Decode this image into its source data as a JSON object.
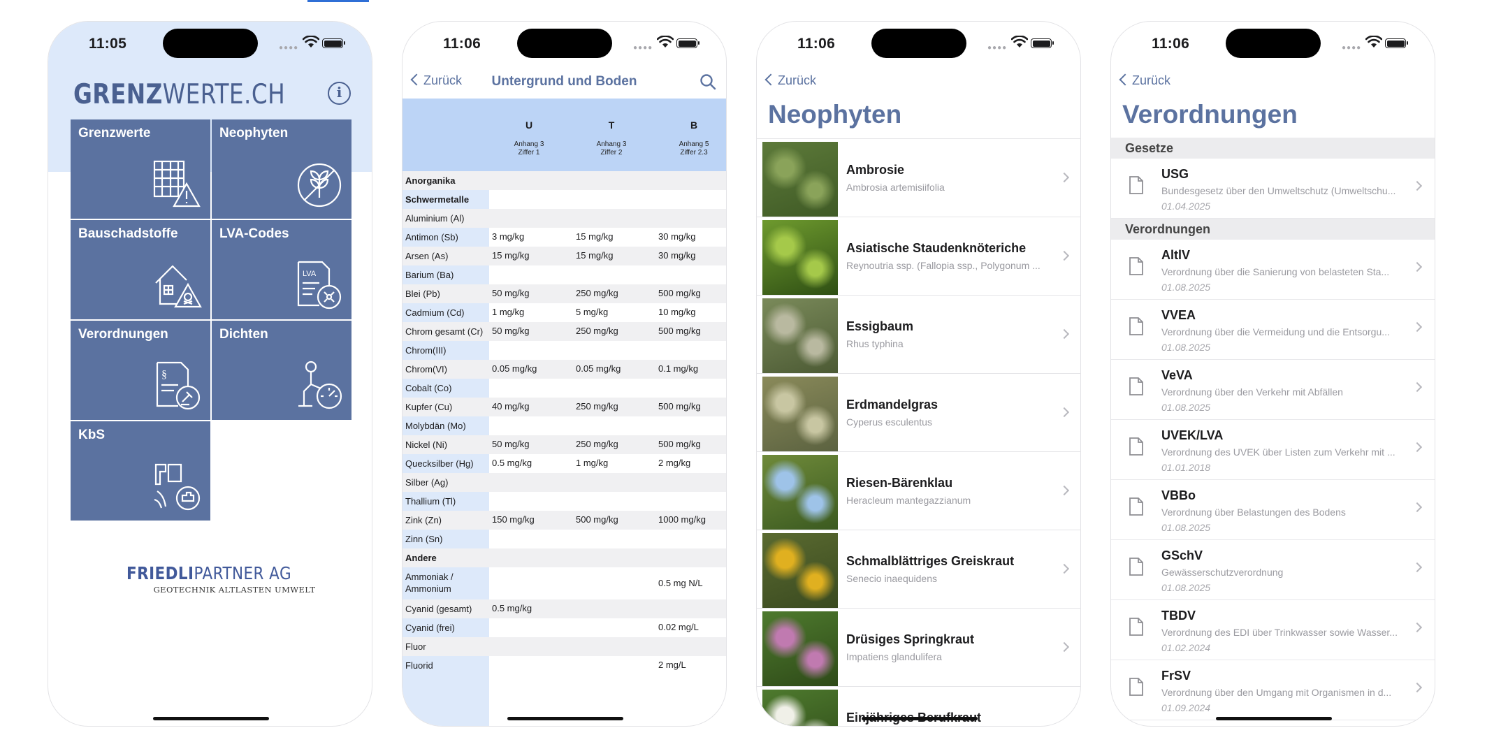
{
  "status": {
    "time_1": "11:05",
    "time_2": "11:06",
    "time_3": "11:06",
    "time_4": "11:06"
  },
  "home": {
    "logo_bold": "GRENZ",
    "logo_regular": "WERTE.CH",
    "tiles": [
      {
        "label": "Grenzwerte",
        "icon": "grid-warning-icon"
      },
      {
        "label": "Neophyten",
        "icon": "plant-circle-icon"
      },
      {
        "label": "Bauschadstoffe",
        "icon": "house-hazard-icon"
      },
      {
        "label": "LVA-Codes",
        "icon": "lva-document-icon"
      },
      {
        "label": "Verordnungen",
        "icon": "legal-document-icon"
      },
      {
        "label": "Dichten",
        "icon": "gauge-person-icon"
      },
      {
        "label": "KbS",
        "icon": "site-document-icon"
      }
    ],
    "company_bold": "FRIEDLI",
    "company_regular": "PARTNER AG",
    "company_tagline": "GEOTECHNIK ALTLASTEN UMWELT"
  },
  "soil": {
    "back": "Zurück",
    "title": "Untergrund und Boden",
    "columns": [
      {
        "key": "U",
        "sub1": "Anhang 3",
        "sub2": "Ziffer 1"
      },
      {
        "key": "T",
        "sub1": "Anhang 3",
        "sub2": "Ziffer 2"
      },
      {
        "key": "B",
        "sub1": "Anhang 5",
        "sub2": "Ziffer 2.3"
      }
    ],
    "rows": [
      {
        "label": "Anorganika",
        "header": true,
        "values": [
          "",
          "",
          ""
        ]
      },
      {
        "label": "Schwermetalle",
        "header": true,
        "values": [
          "",
          "",
          ""
        ]
      },
      {
        "label": "Aluminium (Al)",
        "values": [
          "",
          "",
          ""
        ]
      },
      {
        "label": "Antimon (Sb)",
        "values": [
          "3 mg/kg",
          "15 mg/kg",
          "30 mg/kg"
        ]
      },
      {
        "label": "Arsen (As)",
        "values": [
          "15 mg/kg",
          "15 mg/kg",
          "30 mg/kg"
        ]
      },
      {
        "label": "Barium (Ba)",
        "values": [
          "",
          "",
          ""
        ]
      },
      {
        "label": "Blei (Pb)",
        "values": [
          "50 mg/kg",
          "250 mg/kg",
          "500 mg/kg"
        ]
      },
      {
        "label": "Cadmium (Cd)",
        "values": [
          "1 mg/kg",
          "5 mg/kg",
          "10 mg/kg"
        ]
      },
      {
        "label": "Chrom gesamt (Cr)",
        "values": [
          "50 mg/kg",
          "250 mg/kg",
          "500 mg/kg"
        ]
      },
      {
        "label": "Chrom(III)",
        "values": [
          "",
          "",
          ""
        ]
      },
      {
        "label": "Chrom(VI)",
        "values": [
          "0.05 mg/kg",
          "0.05 mg/kg",
          "0.1 mg/kg"
        ]
      },
      {
        "label": "Cobalt (Co)",
        "values": [
          "",
          "",
          ""
        ]
      },
      {
        "label": "Kupfer (Cu)",
        "values": [
          "40 mg/kg",
          "250 mg/kg",
          "500 mg/kg"
        ]
      },
      {
        "label": "Molybdän (Mo)",
        "values": [
          "",
          "",
          ""
        ]
      },
      {
        "label": "Nickel (Ni)",
        "values": [
          "50 mg/kg",
          "250 mg/kg",
          "500 mg/kg"
        ]
      },
      {
        "label": "Quecksilber (Hg)",
        "values": [
          "0.5 mg/kg",
          "1 mg/kg",
          "2 mg/kg"
        ]
      },
      {
        "label": "Silber (Ag)",
        "values": [
          "",
          "",
          ""
        ]
      },
      {
        "label": "Thallium (Tl)",
        "values": [
          "",
          "",
          ""
        ]
      },
      {
        "label": "Zink (Zn)",
        "values": [
          "150 mg/kg",
          "500 mg/kg",
          "1000 mg/kg"
        ]
      },
      {
        "label": "Zinn (Sn)",
        "values": [
          "",
          "",
          ""
        ]
      },
      {
        "label": "Andere",
        "header": true,
        "values": [
          "",
          "",
          ""
        ]
      },
      {
        "label": "Ammoniak / Ammonium",
        "values": [
          "",
          "",
          "0.5 mg N/L"
        ]
      },
      {
        "label": "Cyanid (gesamt)",
        "values": [
          "0.5 mg/kg",
          "",
          ""
        ]
      },
      {
        "label": "Cyanid (frei)",
        "values": [
          "",
          "",
          "0.02 mg/L"
        ]
      },
      {
        "label": "Fluor",
        "values": [
          "",
          "",
          ""
        ]
      },
      {
        "label": "Fluorid",
        "values": [
          "",
          "",
          "2 mg/L"
        ]
      }
    ]
  },
  "neo": {
    "back": "Zurück",
    "title": "Neophyten",
    "items": [
      {
        "name": "Ambrosie",
        "latin": "Ambrosia artemisiifolia",
        "colors": [
          "#5d7a3a",
          "#8aa35a",
          "#3f5a25"
        ]
      },
      {
        "name": "Asiatische Staudenknöteriche",
        "latin": "Reynoutria ssp. (Fallopia ssp., Polygonum ...",
        "colors": [
          "#6e9a2e",
          "#a5c94a",
          "#2f4f14"
        ]
      },
      {
        "name": "Essigbaum",
        "latin": "Rhus typhina",
        "colors": [
          "#7a8a5a",
          "#b9b9a0",
          "#4c5a34"
        ]
      },
      {
        "name": "Erdmandelgras",
        "latin": "Cyperus esculentus",
        "colors": [
          "#8a8a5a",
          "#c8c6a2",
          "#5b6240"
        ]
      },
      {
        "name": "Riesen-Bärenklau",
        "latin": "Heracleum mantegazzianum",
        "colors": [
          "#6f8a3a",
          "#9ec3e8",
          "#3b5a20"
        ]
      },
      {
        "name": "Schmalblättriges Greiskraut",
        "latin": "Senecio inaequidens",
        "colors": [
          "#5a6a30",
          "#e0b020",
          "#3a4a20"
        ]
      },
      {
        "name": "Drüsiges Springkraut",
        "latin": "Impatiens glandulifera",
        "colors": [
          "#4e7a2e",
          "#c07ab0",
          "#2e4a18"
        ]
      },
      {
        "name": "Einjähriges Berufkraut",
        "latin": "",
        "colors": [
          "#4e7a2e",
          "#f0f0e8",
          "#2e4a18"
        ]
      }
    ]
  },
  "laws": {
    "back": "Zurück",
    "title": "Verordnungen",
    "section_1": "Gesetze",
    "section_2": "Verordnungen",
    "gesetze": [
      {
        "abbr": "USG",
        "desc": "Bundesgesetz über den Umweltschutz (Umweltschu...",
        "date": "01.04.2025"
      }
    ],
    "verordnungen": [
      {
        "abbr": "AltlV",
        "desc": "Verordnung über die Sanierung von belasteten Sta...",
        "date": "01.08.2025"
      },
      {
        "abbr": "VVEA",
        "desc": "Verordnung über die Vermeidung und die Entsorgu...",
        "date": "01.08.2025"
      },
      {
        "abbr": "VeVA",
        "desc": "Verordnung über den Verkehr mit Abfällen",
        "date": "01.08.2025"
      },
      {
        "abbr": "UVEK/LVA",
        "desc": "Verordnung des UVEK über Listen zum Verkehr mit ...",
        "date": "01.01.2018"
      },
      {
        "abbr": "VBBo",
        "desc": "Verordnung über Belastungen des Bodens",
        "date": "01.08.2025"
      },
      {
        "abbr": "GSchV",
        "desc": "Gewässerschutzverordnung",
        "date": "01.08.2025"
      },
      {
        "abbr": "TBDV",
        "desc": "Verordnung des EDI über Trinkwasser sowie Wasser...",
        "date": "01.02.2024"
      },
      {
        "abbr": "FrSV",
        "desc": "Verordnung über den Umgang mit Organismen in d...",
        "date": "01.09.2024"
      }
    ]
  }
}
